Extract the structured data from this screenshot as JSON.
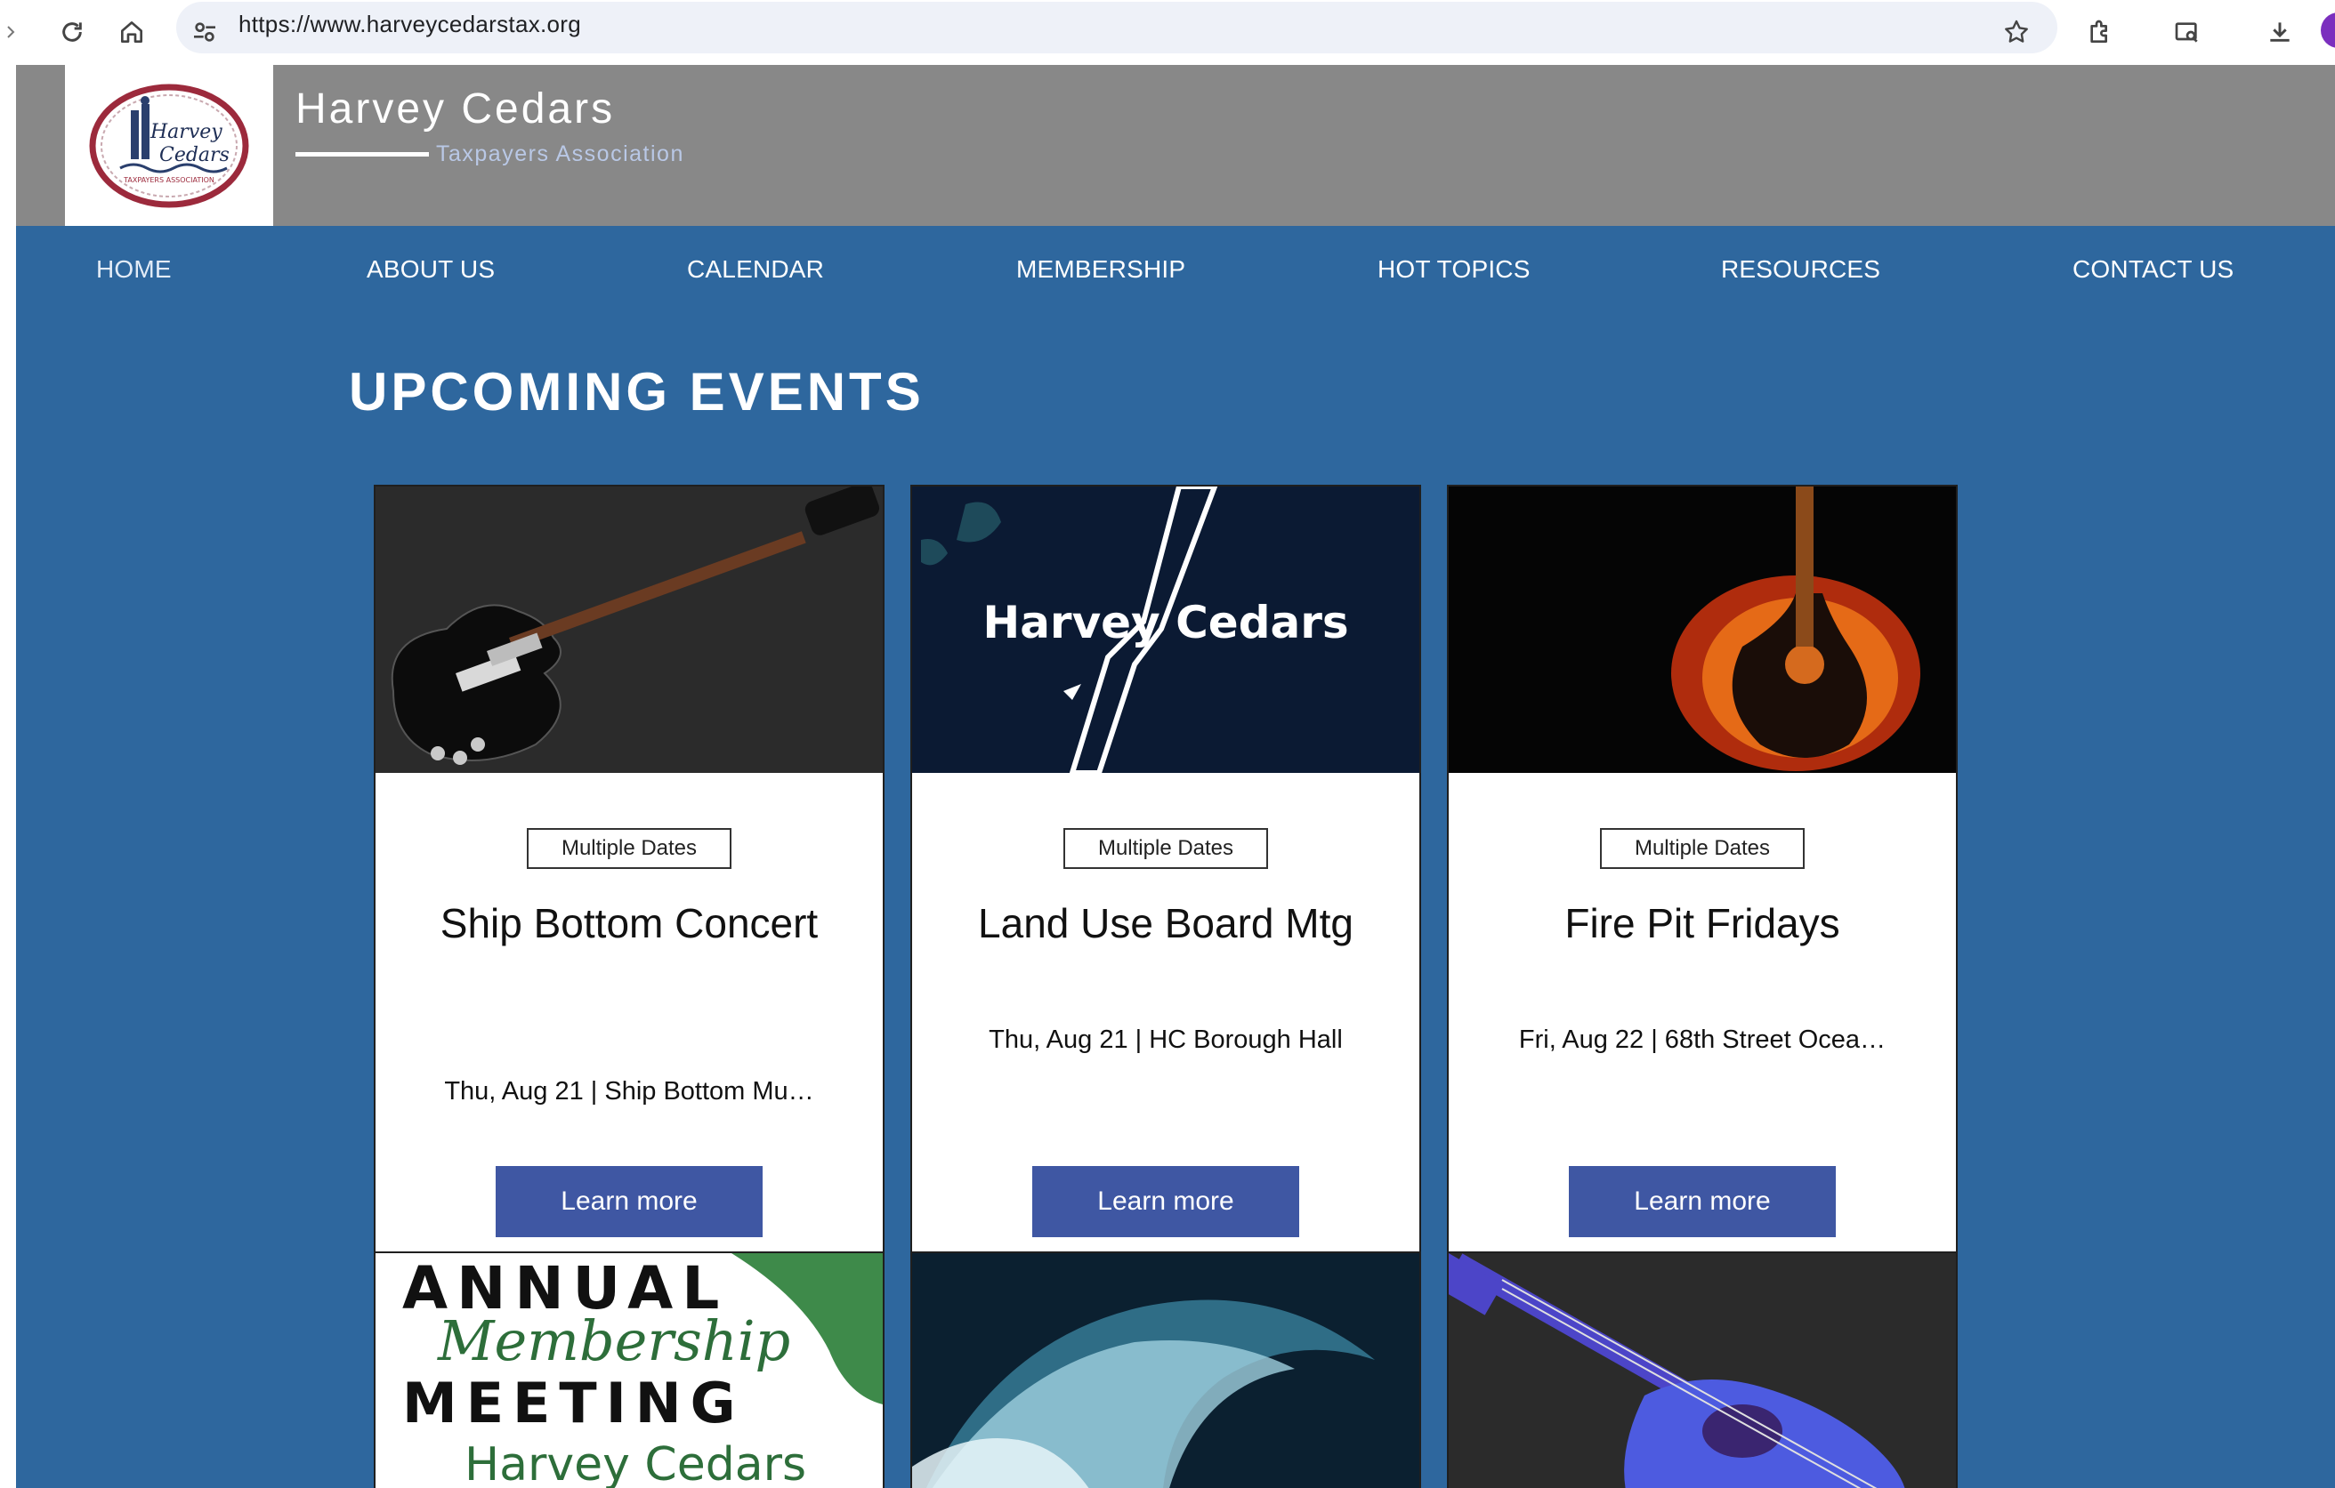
{
  "browser": {
    "url": "https://www.harveycedarstax.org",
    "icons": [
      "reload-icon",
      "home-icon",
      "site-settings-icon",
      "bookmark-star-icon",
      "extensions-icon",
      "search-tab-icon",
      "download-icon"
    ]
  },
  "header": {
    "logo_alt": "Harvey Cedars Taxpayers Association logo",
    "logo_text_line1": "Harvey",
    "logo_text_line2": "Cedars",
    "logo_text_ring": "TAXPAYERS ASSOCIATION",
    "title": "Harvey Cedars",
    "subtitle": "Taxpayers Association"
  },
  "nav": {
    "items": [
      {
        "label": "HOME",
        "active": true
      },
      {
        "label": "ABOUT US"
      },
      {
        "label": "CALENDAR"
      },
      {
        "label": "MEMBERSHIP"
      },
      {
        "label": "HOT TOPICS"
      },
      {
        "label": "RESOURCES"
      },
      {
        "label": "CONTACT US"
      }
    ]
  },
  "main": {
    "section_title": "UPCOMING EVENTS",
    "events": [
      {
        "badge": "Multiple Dates",
        "title": "Ship Bottom Concert",
        "meta": "Thu, Aug 21  |  Ship Bottom Mu…",
        "button": "Learn more",
        "image": "black-electric-guitar"
      },
      {
        "badge": "Multiple Dates",
        "title": "Land Use Board Mtg",
        "meta": "Thu, Aug 21  |  HC Borough Hall",
        "button": "Learn more",
        "image": "harvey-cedars-map",
        "image_text": "Harvey Cedars"
      },
      {
        "badge": "Multiple Dates",
        "title": "Fire Pit Fridays",
        "meta": "Fri, Aug 22  |  68th Street Ocea…",
        "button": "Learn more",
        "image": "flaming-acoustic-guitar"
      }
    ],
    "events_row2": [
      {
        "image": "annual-membership-meeting",
        "image_text_1": "ANNUAL",
        "image_text_2": "Membership",
        "image_text_3": "MEETING",
        "image_text_4": "Harvey Cedars"
      },
      {
        "image": "ocean-wave"
      },
      {
        "image": "blue-acoustic-guitar"
      }
    ]
  },
  "colors": {
    "page_bg": "#2e679e",
    "header_bg": "#888888",
    "button_bg": "#3f57a3"
  }
}
